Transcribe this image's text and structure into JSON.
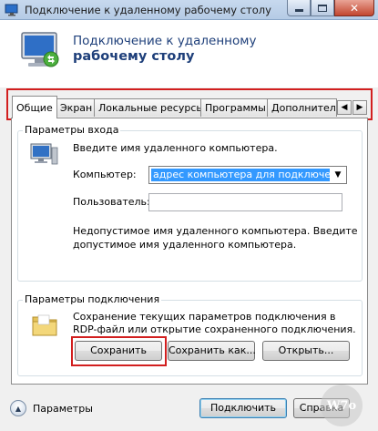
{
  "window": {
    "title": "Подключение к удаленному рабочему столу",
    "header_line1": "Подключение к удаленному",
    "header_line2": "рабочему столу"
  },
  "tabs": [
    {
      "label": "Общие",
      "active": true
    },
    {
      "label": "Экран",
      "active": false
    },
    {
      "label": "Локальные ресурсы",
      "active": false
    },
    {
      "label": "Программы",
      "active": false
    },
    {
      "label": "Дополнитель",
      "active": false
    }
  ],
  "tab_scroll": {
    "left_icon": "chevron-left-icon",
    "right_icon": "chevron-right-icon"
  },
  "logon": {
    "group_title": "Параметры входа",
    "prompt": "Введите имя удаленного компьютера.",
    "computer_label": "Компьютер:",
    "computer_value": "адрес компьютера для подключения>",
    "user_label": "Пользователь:",
    "user_value": "",
    "error_text_line1": "Недопустимое имя удаленного компьютера. Введите",
    "error_text_line2": "допустимое имя удаленного компьютера."
  },
  "connection": {
    "group_title": "Параметры подключения",
    "desc_line1": "Сохранение текущих параметров подключения в",
    "desc_line2": "RDP-файл или открытие сохраненного подключения.",
    "save_label": "Сохранить",
    "save_as_label": "Сохранить как...",
    "open_label": "Открыть..."
  },
  "footer": {
    "options_label": "Параметры",
    "connect_label": "Подключить",
    "help_label": "Справка"
  },
  "watermark": "W7o",
  "colors": {
    "highlight_outline": "#d21f1f",
    "title_blue": "#1e3f7a",
    "selection": "#3399ff"
  }
}
